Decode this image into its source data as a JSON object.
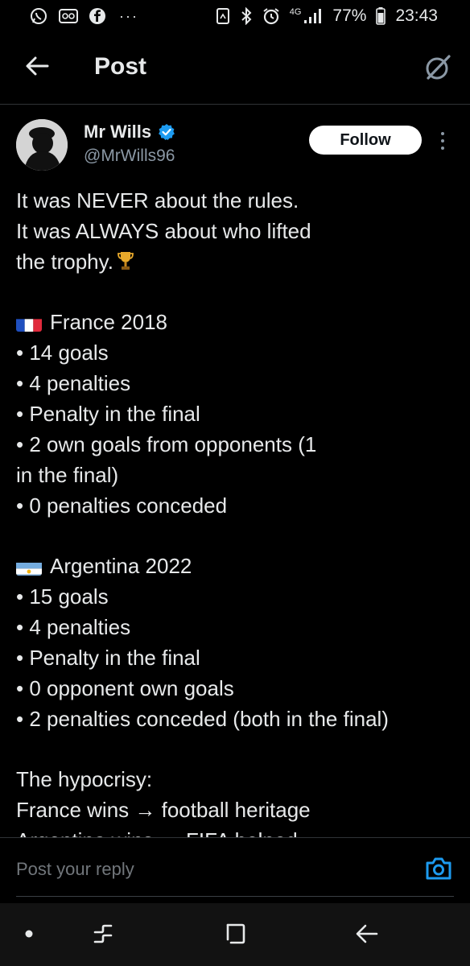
{
  "status_bar": {
    "left_icons": [
      "whatsapp-icon",
      "voicemail-icon",
      "facebook-icon"
    ],
    "more": "···",
    "right_icons": [
      "nfc-icon",
      "bluetooth-icon",
      "alarm-icon"
    ],
    "network": "4G",
    "battery": "77%",
    "time": "23:43"
  },
  "header": {
    "title": "Post",
    "back_icon": "arrow-left-icon",
    "grok_icon": "grok-icon"
  },
  "post": {
    "author_name": "Mr Wills",
    "handle": "@MrWills96",
    "verified": true,
    "follow_label": "Follow",
    "lines": [
      "It was NEVER about the rules.",
      "It was ALWAYS about who lifted",
      "the trophy.",
      "",
      "France 2018",
      "• 14 goals",
      "• 4 penalties",
      "• Penalty in the final",
      "• 2 own goals from opponents (1",
      "in the final)",
      "• 0 penalties conceded",
      "",
      "Argentina 2022",
      "• 15 goals",
      "• 4 penalties",
      "• Penalty in the final",
      "• 0 opponent own goals",
      "• 2 penalties conceded (both in the final)",
      "",
      "The hypocrisy:",
      "France wins → football heritage",
      "Argentina wins → FIFA helped"
    ]
  },
  "reply": {
    "placeholder": "Post your reply",
    "camera_icon": "camera-icon"
  },
  "nav": {
    "buttons": [
      "home-dot-icon",
      "recents-icon",
      "home-square-icon",
      "back-icon"
    ]
  },
  "colors": {
    "background": "#000000",
    "text": "#e7e9ea",
    "secondary_text": "#8b98a5",
    "accent": "#1d9bf0",
    "divider": "#2f3336"
  }
}
